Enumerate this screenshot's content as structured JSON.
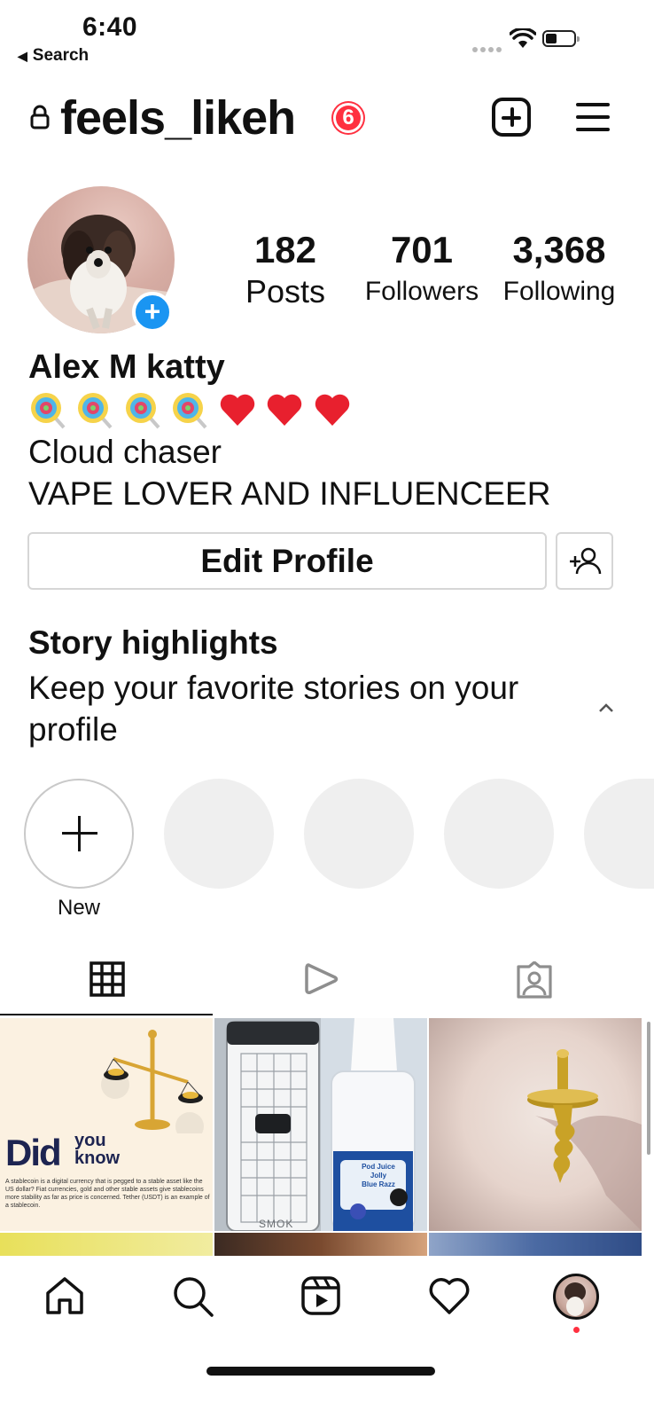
{
  "status_bar": {
    "time": "6:40",
    "back_label": "Search"
  },
  "header": {
    "username": "feels_likeh",
    "notification_count": "6",
    "icons": [
      "lock-icon",
      "create-icon",
      "menu-icon"
    ]
  },
  "profile": {
    "stats": [
      {
        "value": "182",
        "label": "Posts"
      },
      {
        "value": "701",
        "label": "Followers"
      },
      {
        "value": "3,368",
        "label": "Following"
      }
    ],
    "display_name": "Alex M katty",
    "emoji_line": "🍭🍭🍭🍭❤️❤️❤️",
    "bio_lines": [
      "Cloud chaser",
      "VAPE LOVER AND INFLUENCEER"
    ],
    "edit_profile_label": "Edit Profile"
  },
  "highlights": {
    "title": "Story highlights",
    "description": "Keep your favorite stories on your profile",
    "new_label": "New"
  },
  "tabs": [
    "grid-tab",
    "reels-tab",
    "tagged-tab"
  ],
  "posts": {
    "tile_1": {
      "headline_big": "Did",
      "headline_small_1": "you",
      "headline_small_2": "know",
      "body": "A stablecoin is a digital currency that is pegged to a stable asset like the US dollar? Fiat currencies, gold and other stable assets give stablecoins more stability as far as price is concerned. Tether (USDT) is an example of a stablecoin."
    },
    "tile_2": {
      "brand": "SMOK",
      "bottle_label_1": "Pod Juice",
      "bottle_label_2": "Jolly",
      "bottle_label_3": "Blue Razz"
    }
  },
  "colors": {
    "accent_blue": "#1a95f2",
    "badge_red": "#ff3040",
    "border_gray": "#d6d6d6"
  }
}
